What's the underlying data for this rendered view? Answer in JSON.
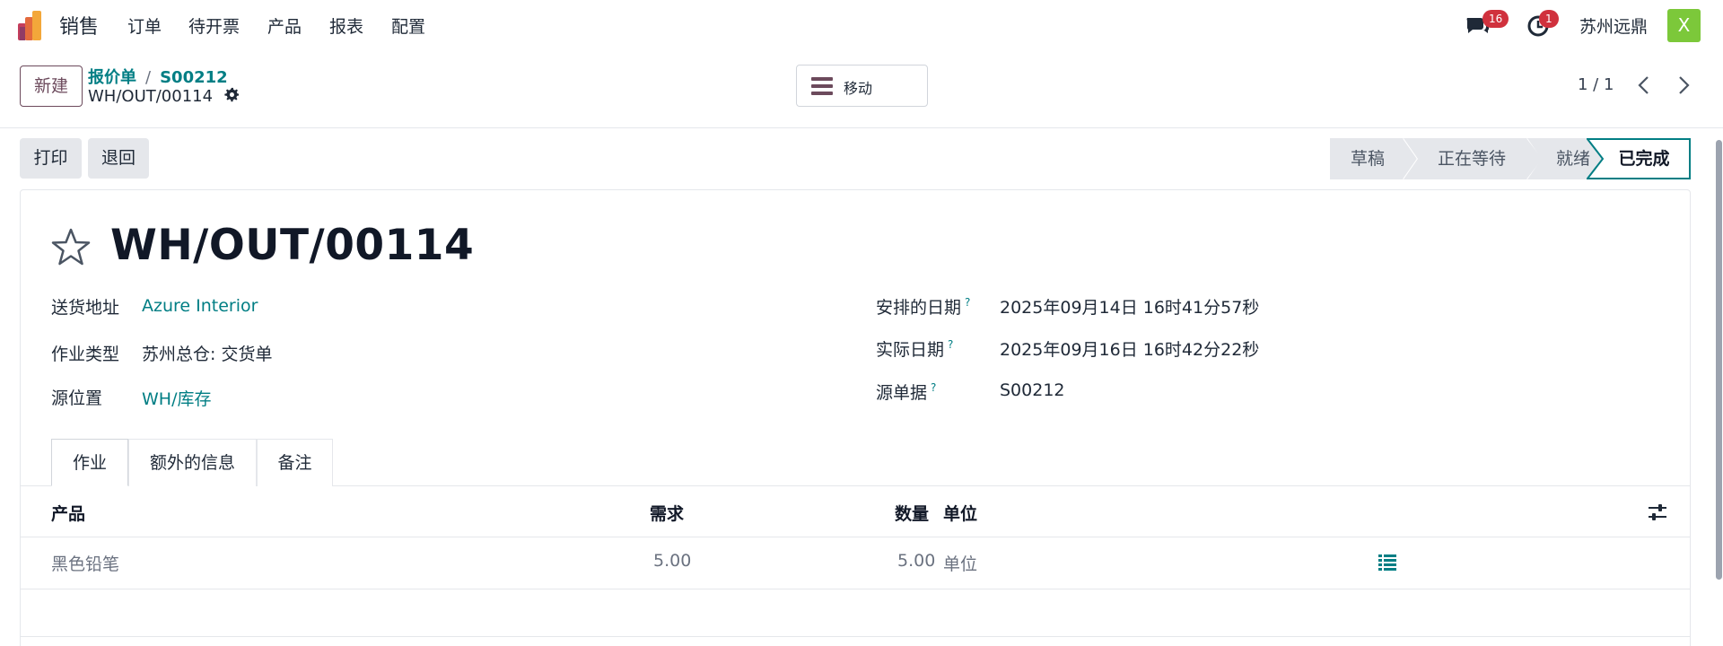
{
  "nav": {
    "app_name": "销售",
    "menu": [
      "订单",
      "待开票",
      "产品",
      "报表",
      "配置"
    ],
    "messages_badge": "16",
    "activity_badge": "1",
    "company": "苏州远鼎",
    "avatar_letter": "X"
  },
  "control": {
    "new_label": "新建",
    "breadcrumb": [
      "报价单",
      "S00212"
    ],
    "record_name": "WH/OUT/00114",
    "move_label": "移动",
    "pager": "1 / 1"
  },
  "actions": {
    "print_label": "打印",
    "return_label": "退回"
  },
  "statusbar": {
    "stages": [
      "草稿",
      "正在等待",
      "就绪",
      "已完成"
    ],
    "current": "已完成"
  },
  "form": {
    "title": "WH/OUT/00114",
    "left_fields": [
      {
        "label": "送货地址",
        "value": "Azure Interior"
      },
      {
        "label": "作业类型",
        "value": "苏州总仓: 交货单"
      },
      {
        "label": "源位置",
        "value": "WH/库存"
      }
    ],
    "right_fields": [
      {
        "label": "安排的日期",
        "help": "?",
        "value": "2025年09月14日 16时41分57秒"
      },
      {
        "label": "实际日期",
        "help": "?",
        "value": "2025年09月16日 16时42分22秒"
      },
      {
        "label": "源单据",
        "help": "?",
        "value": "S00212"
      }
    ]
  },
  "tabs": [
    "作业",
    "额外的信息",
    "备注"
  ],
  "table": {
    "headers": [
      "产品",
      "需求",
      "数量",
      "单位"
    ],
    "rows": [
      {
        "product": "黑色铅笔",
        "demand": "5.00",
        "quantity": "5.00",
        "uom": "单位"
      }
    ]
  },
  "colors": {
    "accent": "#017e84",
    "brand": "#6c4a5c",
    "badge": "#d0313d",
    "avatar": "#7cc83a"
  }
}
